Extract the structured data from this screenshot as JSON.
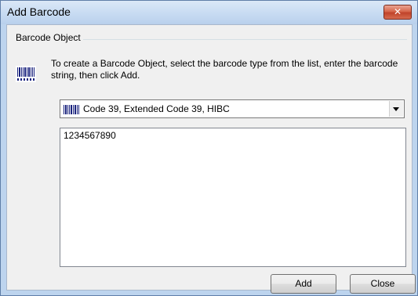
{
  "window": {
    "title": "Add Barcode",
    "close_glyph": "✕"
  },
  "group": {
    "label": "Barcode Object",
    "icon": "barcode-icon",
    "instructions": "To create a Barcode Object, select the barcode type from the list, enter the barcode string, then click Add."
  },
  "barcode_type": {
    "selected": "Code 39, Extended Code 39, HIBC",
    "icon": "barcode-small-icon"
  },
  "barcode_string": {
    "value": "1234567890"
  },
  "buttons": {
    "add": "Add",
    "close": "Close"
  },
  "colors": {
    "title_bar": "#c7dbf2",
    "close_button": "#c0432a",
    "dialog_face": "#f0f0f0"
  }
}
